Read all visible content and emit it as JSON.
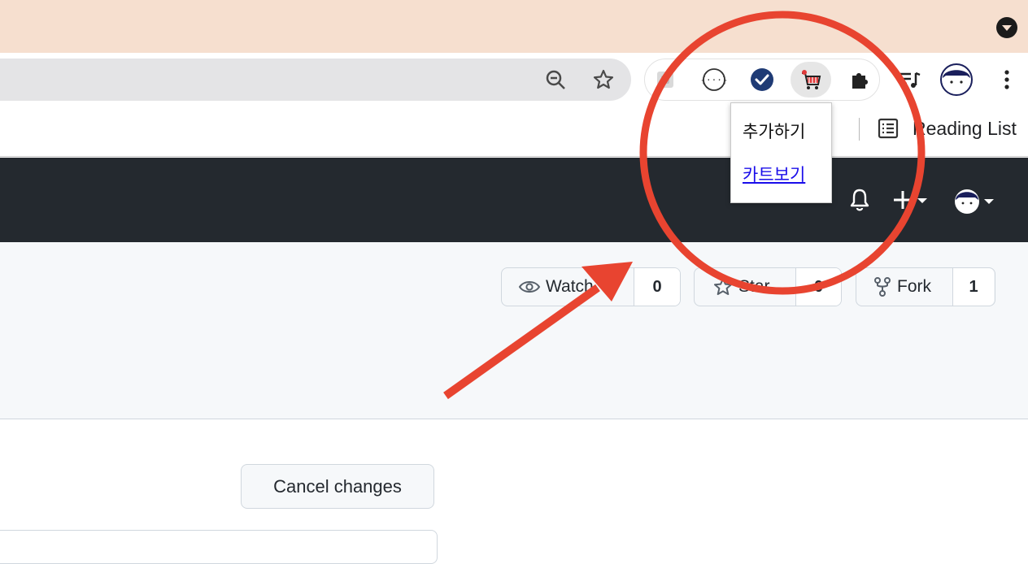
{
  "browser": {
    "toolbar": {
      "icons": [
        "zoom-out-icon",
        "bookmark-star-icon"
      ],
      "extensions": [
        "blurred-extension-icon",
        "json-viewer-icon",
        "checkmark-extension-icon",
        "shopping-cart-extension-icon",
        "puzzle-icon"
      ],
      "right_icons": [
        "playlist-icon",
        "profile-avatar-icon",
        "more-vert-icon"
      ]
    },
    "bookmarks_bar": {
      "reading_list_label": "Reading List"
    }
  },
  "extension_popup": {
    "add_label": "추가하기",
    "view_cart_label": "카트보기"
  },
  "github_header": {
    "icons": [
      "bell-icon",
      "plus-icon",
      "avatar-icon"
    ]
  },
  "repo_actions": {
    "watch_label": "Watch",
    "watch_count": "0",
    "star_label": "Star",
    "star_count": "0",
    "fork_label": "Fork",
    "fork_count": "1"
  },
  "editor": {
    "cancel_label": "Cancel changes"
  },
  "annotation": {
    "color": "#e84430"
  }
}
